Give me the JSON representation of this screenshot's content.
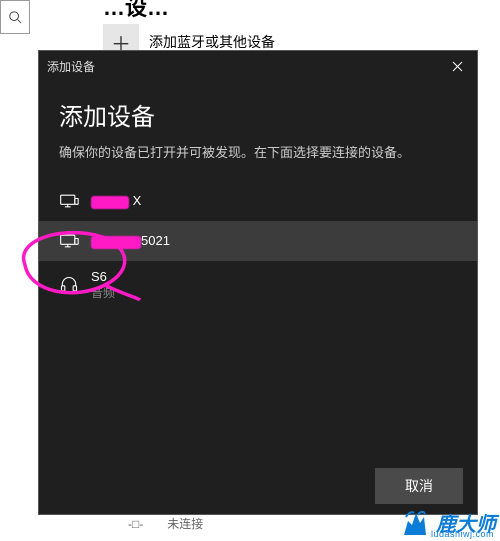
{
  "page": {
    "heading_partial": "…设…",
    "add_device_label": "添加蓝牙或其他设备"
  },
  "dialog": {
    "titlebar": "添加设备",
    "heading": "添加设备",
    "subtitle": "确保你的设备已打开并可被发现。在下面选择要连接的设备。",
    "devices": [
      {
        "name_suffix": " X",
        "subtitle": ""
      },
      {
        "name_suffix": "5021",
        "subtitle": ""
      },
      {
        "name": "S6",
        "subtitle": "音频"
      }
    ],
    "cancel": "取消"
  },
  "status": {
    "not_connected": "未连接"
  },
  "watermark": {
    "brand": "鹿大师",
    "url": "ludashiwj.com"
  }
}
